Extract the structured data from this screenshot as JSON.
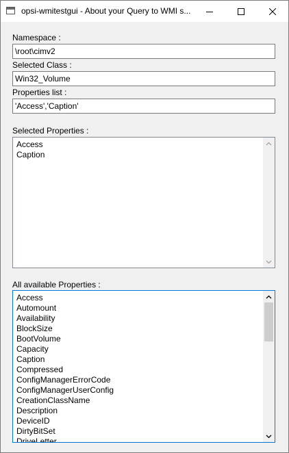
{
  "window": {
    "title": "opsi-wmitestgui - About your Query to WMI s..."
  },
  "form": {
    "namespace_label": "Namespace :",
    "namespace_value": "\\root\\cimv2",
    "class_label": "Selected Class :",
    "class_value": "Win32_Volume",
    "properties_list_label": "Properties list :",
    "properties_list_value": "'Access','Caption'",
    "selected_properties_label": "Selected Properties :",
    "selected_properties": [
      "Access",
      "Caption"
    ],
    "available_properties_label": "All available Properties :",
    "available_properties": [
      "Access",
      "Automount",
      "Availability",
      "BlockSize",
      "BootVolume",
      "Capacity",
      "Caption",
      "Compressed",
      "ConfigManagerErrorCode",
      "ConfigManagerUserConfig",
      "CreationClassName",
      "Description",
      "DeviceID",
      "DirtyBitSet",
      "DriveLetter"
    ],
    "available_scroll_position": 0
  },
  "icons": {
    "app": "app-window-icon",
    "minimize": "minimize-icon",
    "maximize": "maximize-icon",
    "close": "close-icon",
    "scroll_up": "chevron-up-icon",
    "scroll_down": "chevron-down-icon"
  },
  "colors": {
    "window_background": "#f0f0f0",
    "field_border": "#7a7a7a",
    "focus_border": "#0078d7",
    "scroll_thumb": "#cdcdcd"
  }
}
